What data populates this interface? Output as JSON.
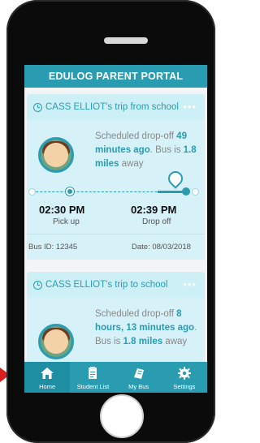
{
  "app": {
    "title": "EDULOG PARENT PORTAL"
  },
  "trips": [
    {
      "title": "CASS ELLIOT's trip from school",
      "menu": "•••",
      "message_prefix": "Scheduled drop-off ",
      "message_em1": "49 minutes ago",
      "message_mid": ". Bus is ",
      "message_em2": "1.8 miles",
      "message_suffix": " away",
      "pickup_time": "02:30 PM",
      "pickup_label": "Pick up",
      "dropoff_time": "02:39 PM",
      "dropoff_label": "Drop off",
      "bus_id": "Bus ID: 12345",
      "date": "Date: 08/03/2018"
    },
    {
      "title": "CASS ELLIOT's trip to school",
      "menu": "•••",
      "message_prefix": "Scheduled drop-off ",
      "message_em1": "8 hours, 13 minutes ago",
      "message_mid": ". Bus is ",
      "message_em2": "1.8 miles",
      "message_suffix": " away"
    }
  ],
  "tabs": [
    {
      "label": "Home",
      "icon": "home-icon",
      "active": true
    },
    {
      "label": "Student List",
      "icon": "document-icon",
      "active": false
    },
    {
      "label": "My Bus",
      "icon": "bus-icon",
      "active": false
    },
    {
      "label": "Settings",
      "icon": "gear-icon",
      "active": false
    }
  ],
  "colors": {
    "accent": "#2a9cb2",
    "card_header": "#cdeff6",
    "card_body": "#d6f1f7",
    "arrow": "#d81f1f"
  }
}
